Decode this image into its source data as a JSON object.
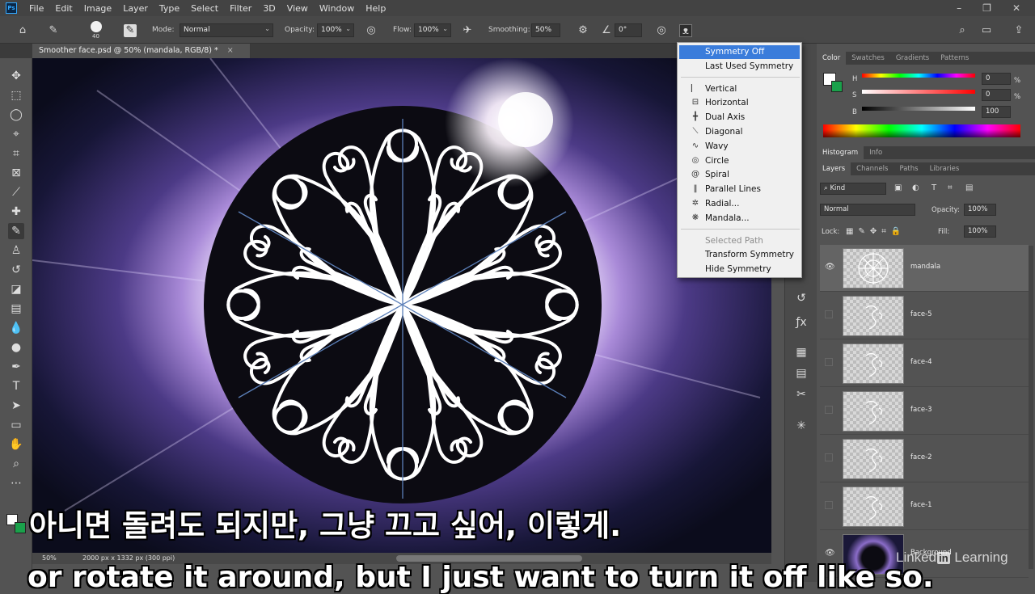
{
  "menubar": {
    "logo": "Ps",
    "items": [
      "File",
      "Edit",
      "Image",
      "Layer",
      "Type",
      "Select",
      "Filter",
      "3D",
      "View",
      "Window",
      "Help"
    ]
  },
  "options": {
    "brush_size": "40",
    "mode_label": "Mode:",
    "mode_value": "Normal",
    "opacity_label": "Opacity:",
    "opacity_value": "100%",
    "flow_label": "Flow:",
    "flow_value": "100%",
    "smoothing_label": "Smoothing:",
    "smoothing_value": "50%",
    "angle_value": "0°"
  },
  "document": {
    "tab_title": "Smoother face.psd @ 50% (mandala, RGB/8) *",
    "zoom": "50%",
    "doc_info": "2000 px x 1332 px (300 ppi)"
  },
  "symmetry_menu": {
    "items": [
      {
        "label": "Symmetry Off",
        "icon": "none"
      },
      {
        "label": "Last Used Symmetry",
        "icon": "none"
      },
      {
        "label": "Vertical",
        "icon": "vertical-axis"
      },
      {
        "label": "Horizontal",
        "icon": "horizontal-axis"
      },
      {
        "label": "Dual Axis",
        "icon": "dual-axis"
      },
      {
        "label": "Diagonal",
        "icon": "diagonal"
      },
      {
        "label": "Wavy",
        "icon": "wavy"
      },
      {
        "label": "Circle",
        "icon": "circle"
      },
      {
        "label": "Spiral",
        "icon": "spiral"
      },
      {
        "label": "Parallel Lines",
        "icon": "parallel-lines"
      },
      {
        "label": "Radial...",
        "icon": "radial"
      },
      {
        "label": "Mandala...",
        "icon": "mandala"
      },
      {
        "label": "Selected Path",
        "icon": "none"
      },
      {
        "label": "Transform Symmetry",
        "icon": "none"
      },
      {
        "label": "Hide Symmetry",
        "icon": "none"
      }
    ]
  },
  "color_panel": {
    "tabs": [
      "Color",
      "Swatches",
      "Gradients",
      "Patterns"
    ],
    "h_label": "H",
    "h_value": "0",
    "s_label": "S",
    "s_value": "0",
    "b_label": "B",
    "b_value": "100",
    "pct": "%"
  },
  "histogram_tabs": [
    "Histogram",
    "Info"
  ],
  "layers_panel": {
    "tabs": [
      "Layers",
      "Channels",
      "Paths",
      "Libraries"
    ],
    "filter_kind": "Kind",
    "blend_mode": "Normal",
    "opacity_label": "Opacity:",
    "opacity_value": "100%",
    "lock_label": "Lock:",
    "fill_label": "Fill:",
    "fill_value": "100%",
    "layers": [
      {
        "name": "mandala",
        "visible": true,
        "selected": true
      },
      {
        "name": "face-5",
        "visible": false,
        "selected": false
      },
      {
        "name": "face-4",
        "visible": false,
        "selected": false
      },
      {
        "name": "face-3",
        "visible": false,
        "selected": false
      },
      {
        "name": "face-2",
        "visible": false,
        "selected": false
      },
      {
        "name": "face-1",
        "visible": false,
        "selected": false
      },
      {
        "name": "Background",
        "visible": true,
        "selected": false
      }
    ]
  },
  "subtitles": {
    "korean": "아니면 돌려도 되지만, 그냥 끄고 싶어, 이렇게.",
    "english": "or rotate it around, but I just want to turn it off like so."
  },
  "watermark": {
    "linked": "Linked",
    "in": "in",
    "learning": " Learning"
  },
  "colors": {
    "menu_highlight": "#3a7cdb",
    "ui_dark": "#535353",
    "mandala_stroke": "#ffffff"
  }
}
